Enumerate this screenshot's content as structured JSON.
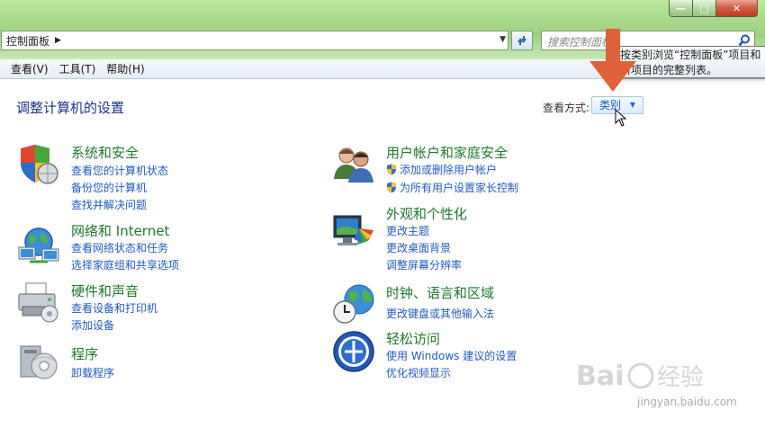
{
  "window": {
    "controls": {
      "minimize": "—",
      "maximize": "□",
      "close": "✕"
    }
  },
  "address": {
    "breadcrumb": "控制面板",
    "search_placeholder": "搜索控制面板"
  },
  "menu": [
    "查看(V)",
    "工具(T)",
    "帮助(H)"
  ],
  "page": {
    "title": "调整计算机的设置",
    "view_by_label": "查看方式:",
    "view_by_value": "类别",
    "tooltip_line1": "按类别浏览“控制面板”项目和",
    "tooltip_line2": "所项目的完整列表。"
  },
  "categories": {
    "system": {
      "title": "系统和安全",
      "links": [
        "查看您的计算机状态",
        "备份您的计算机",
        "查找并解决问题"
      ]
    },
    "network": {
      "title": "网络和 Internet",
      "links": [
        "查看网络状态和任务",
        "选择家庭组和共享选项"
      ]
    },
    "hardware": {
      "title": "硬件和声音",
      "links": [
        "查看设备和打印机",
        "添加设备"
      ]
    },
    "programs": {
      "title": "程序",
      "links": [
        "卸载程序"
      ]
    },
    "users": {
      "title": "用户帐户和家庭安全",
      "links": [
        "添加或删除用户帐户",
        "为所有用户设置家长控制"
      ]
    },
    "appearance": {
      "title": "外观和个性化",
      "links": [
        "更改主题",
        "更改桌面背景",
        "调整屏幕分辨率"
      ]
    },
    "clock": {
      "title": "时钟、语言和区域",
      "links": [
        "更改键盘或其他输入法"
      ]
    },
    "access": {
      "title": "轻松访问",
      "links": [
        "使用 Windows 建议的设置",
        "优化视频显示"
      ]
    }
  },
  "watermark": {
    "brand": "Baidu经验",
    "url": "jingyan.baidu.com"
  },
  "colors": {
    "frame": "#a8d88c",
    "category_title": "#1f7a2c",
    "link": "#1f5bc2",
    "page_title": "#1e3287",
    "annotation_arrow": "#e0623a"
  }
}
